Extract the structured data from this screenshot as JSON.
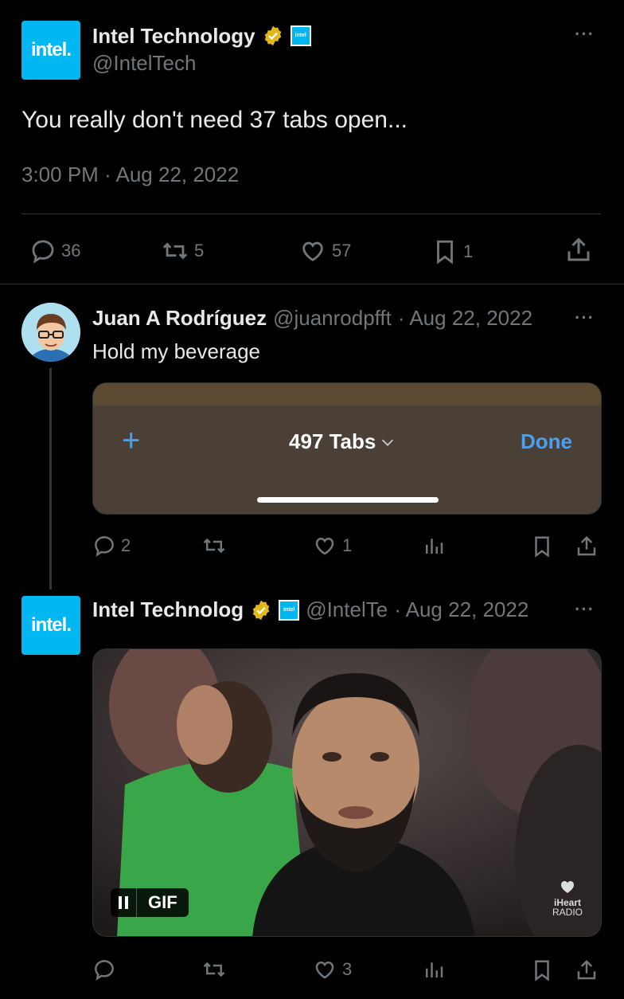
{
  "main_tweet": {
    "author_name": "Intel Technology",
    "author_handle": "@IntelTech",
    "logo_text": "intel.",
    "affiliate_badge_text": "intel",
    "text": "You really don't need 37 tabs open...",
    "timestamp": "3:00 PM · Aug 22, 2022",
    "stats": {
      "replies": "36",
      "retweets": "5",
      "likes": "57",
      "bookmarks": "1"
    },
    "more_label": "···"
  },
  "reply_1": {
    "author_name": "Juan A Rodríguez",
    "author_handle": "@juanrodpfft",
    "date": "· Aug 22, 2022",
    "text": "Hold my beverage",
    "media": {
      "plus_label": "+",
      "tabs_label": "497 Tabs",
      "done_label": "Done"
    },
    "stats": {
      "replies": "2",
      "retweets": "",
      "likes": "1"
    },
    "more_label": "···"
  },
  "reply_2": {
    "author_name": "Intel Technolog",
    "author_handle": "@IntelTe",
    "date": "· Aug 22, 2022",
    "logo_text": "intel.",
    "affiliate_badge_text": "intel",
    "media": {
      "gif_label": "GIF",
      "watermark_top": "iHeart",
      "watermark_bottom": "RADIO"
    },
    "stats": {
      "replies": "",
      "retweets": "",
      "likes": "3"
    },
    "more_label": "···"
  },
  "colors": {
    "accent": "#1d9bf0",
    "intel_blue": "#00b7f1",
    "verified_gold": "#e2b719",
    "text_muted": "#71767b"
  }
}
